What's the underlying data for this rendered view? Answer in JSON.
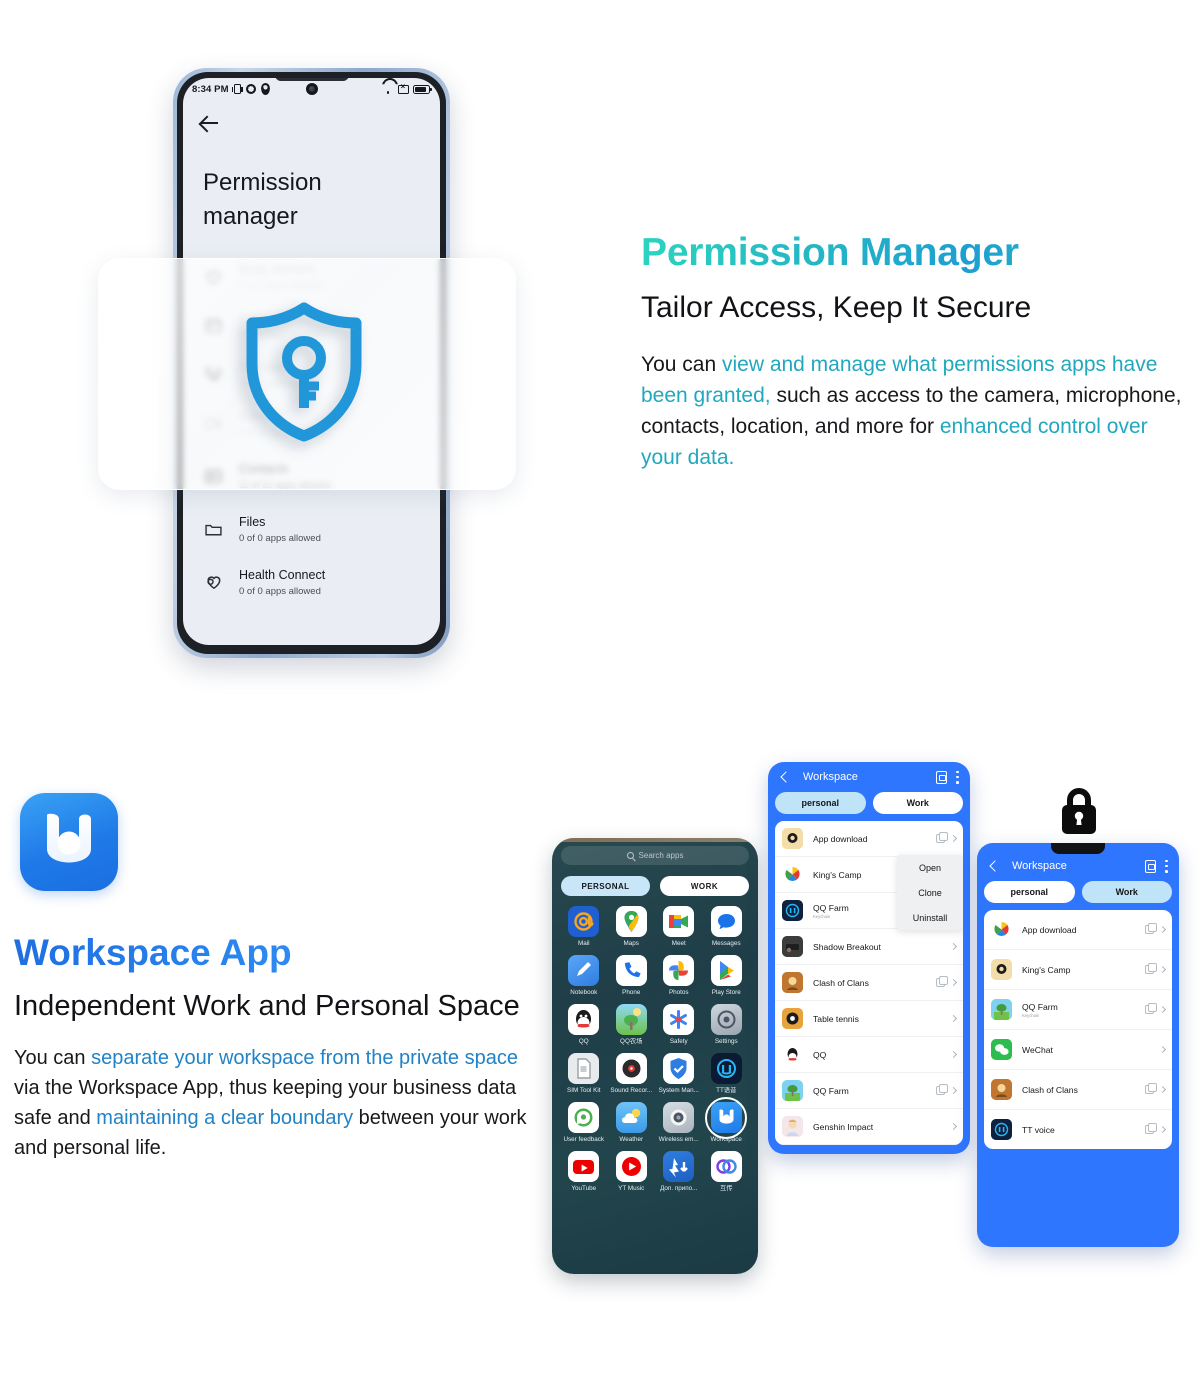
{
  "section1": {
    "phone": {
      "status_bar": {
        "time": "8:34 PM",
        "icons_left": [
          "vibrate-icon",
          "gear-icon",
          "location-icon"
        ],
        "icons_right": [
          "wifi-icon",
          "sim-off-icon",
          "battery-icon"
        ]
      },
      "back_icon": "back-arrow-icon",
      "screen_title": "Permission manager",
      "permissions": [
        {
          "name": "Body sensors",
          "sub": "0 of 0 apps allowed",
          "icon": "heart-icon"
        },
        {
          "name": "Calendar",
          "sub": "4 of 8 apps allowed",
          "icon": "calendar-icon"
        },
        {
          "name": "Call logs",
          "sub": "6 of 6 apps allowed",
          "icon": "call-log-icon"
        },
        {
          "name": "Camera",
          "sub": "4 of 17 apps allowed",
          "icon": "camera-icon"
        },
        {
          "name": "Contacts",
          "sub": "11 of 21 apps allowed",
          "icon": "contacts-icon"
        },
        {
          "name": "Files",
          "sub": "0 of 0 apps allowed",
          "icon": "folder-icon"
        },
        {
          "name": "Health Connect",
          "sub": "0 of 0 apps allowed",
          "icon": "health-icon"
        }
      ]
    },
    "overlay_icon": "shield-key-icon",
    "heading": "Permission Manager",
    "subheading": "Tailor Access, Keep It Secure",
    "body": {
      "p1": "You can ",
      "hl1": "view and manage what permissions apps have been granted,",
      "p2": " such as access to the camera, microphone, contacts, location, and more for ",
      "hl2": "enhanced control over your data."
    }
  },
  "section2": {
    "app_icon": "workspace-app-icon",
    "heading": "Workspace App",
    "subheading": "Independent Work and Personal Space",
    "body": {
      "p1": "You can ",
      "hl1": "separate your workspace from the private space",
      "p2": " via the Workspace App, thus keeping your business data safe and ",
      "hl2": "maintaining a clear boundary",
      "p3": " between your work and personal life."
    },
    "launcher": {
      "search_placeholder": "Search apps",
      "search_icon": "search-icon",
      "tabs": [
        {
          "label": "PERSONAL",
          "active": true
        },
        {
          "label": "WORK",
          "active": false
        }
      ],
      "apps": [
        {
          "label": "Mail"
        },
        {
          "label": "Maps"
        },
        {
          "label": "Meet"
        },
        {
          "label": "Messages"
        },
        {
          "label": "Notebook"
        },
        {
          "label": "Phone"
        },
        {
          "label": "Photos"
        },
        {
          "label": "Play Store"
        },
        {
          "label": "QQ"
        },
        {
          "label": "QQ农场"
        },
        {
          "label": "Safety"
        },
        {
          "label": "Settings"
        },
        {
          "label": "SIM Tool Kit"
        },
        {
          "label": "Sound Recor..."
        },
        {
          "label": "System Man..."
        },
        {
          "label": "TT语音"
        },
        {
          "label": "User feedback"
        },
        {
          "label": "Weather"
        },
        {
          "label": "Wireless em..."
        },
        {
          "label": "Workspace",
          "highlighted": true
        },
        {
          "label": "YouTube"
        },
        {
          "label": "YT Music"
        },
        {
          "label": "Доп. припо..."
        },
        {
          "label": "互传"
        }
      ]
    },
    "workspace_personal": {
      "title": "Workspace",
      "back_icon": "back-chevron-icon",
      "header_icons": [
        "document-scan-icon",
        "overflow-menu-icon"
      ],
      "tabs": [
        {
          "label": "personal",
          "active": true
        },
        {
          "label": "Work",
          "active": false
        }
      ],
      "rows": [
        {
          "name": "App download",
          "clone": true,
          "sub": ""
        },
        {
          "name": "King's Camp",
          "clone": false,
          "sub": ""
        },
        {
          "name": "QQ Farm",
          "clone": false,
          "sub": "Keychain"
        },
        {
          "name": "Shadow Breakout",
          "clone": false,
          "sub": ""
        },
        {
          "name": "Clash of Clans",
          "clone": true,
          "sub": ""
        },
        {
          "name": "Table tennis",
          "clone": false,
          "sub": ""
        },
        {
          "name": "QQ",
          "clone": false,
          "sub": ""
        },
        {
          "name": "QQ Farm",
          "clone": true,
          "sub": ""
        },
        {
          "name": "Genshin Impact",
          "clone": false,
          "sub": ""
        }
      ],
      "context_menu": [
        "Open",
        "Clone",
        "Uninstall"
      ]
    },
    "workspace_work": {
      "title": "Workspace",
      "back_icon": "back-chevron-icon",
      "header_icons": [
        "document-scan-icon",
        "overflow-menu-icon"
      ],
      "lock_icon": "padlock-icon",
      "tabs": [
        {
          "label": "personal",
          "active": false
        },
        {
          "label": "Work",
          "active": true
        }
      ],
      "rows": [
        {
          "name": "App download",
          "clone": true,
          "sub": ""
        },
        {
          "name": "King's Camp",
          "clone": true,
          "sub": ""
        },
        {
          "name": "QQ Farm",
          "clone": true,
          "sub": "Keychain"
        },
        {
          "name": "WeChat",
          "clone": false,
          "sub": ""
        },
        {
          "name": "Clash of Clans",
          "clone": true,
          "sub": ""
        },
        {
          "name": "TT voice",
          "clone": true,
          "sub": ""
        }
      ]
    }
  },
  "colors": {
    "teal": "#2dd4bf",
    "teal_dark": "#21a8bd",
    "blue": "#2083c8",
    "brand_blue": "#2f76ff",
    "shield_blue": "#2196d9",
    "workspace_icon_blue": "#1f7ae8"
  }
}
